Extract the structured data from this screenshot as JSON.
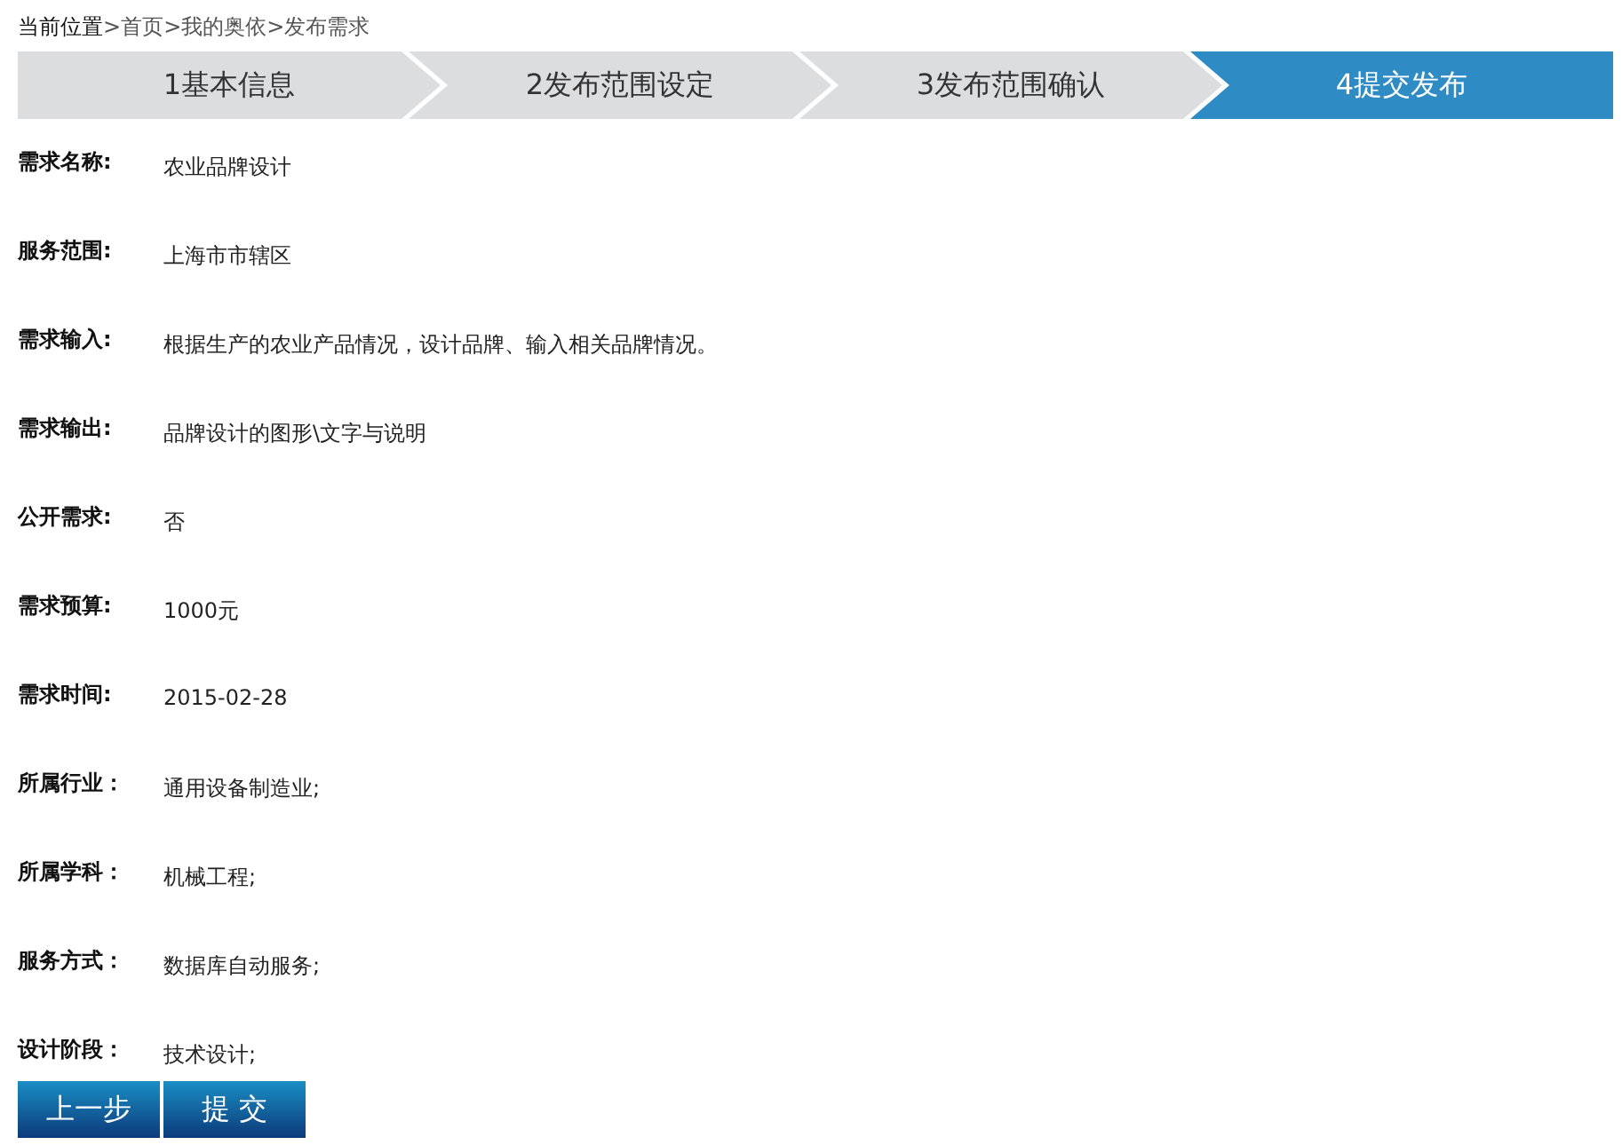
{
  "breadcrumb": {
    "label": "当前位置",
    "separator": ">",
    "items": [
      "首页",
      "我的奥依",
      "发布需求"
    ]
  },
  "steps": [
    {
      "label": "1基本信息",
      "selected": false
    },
    {
      "label": "2发布范围设定",
      "selected": false
    },
    {
      "label": "3发布范围确认",
      "selected": false
    },
    {
      "label": "4提交发布",
      "selected": true
    }
  ],
  "fields": [
    {
      "label": "需求名称:",
      "value": "农业品牌设计"
    },
    {
      "label": "服务范围:",
      "value": "上海市市辖区"
    },
    {
      "label": "需求输入:",
      "value": "根据生产的农业产品情况，设计品牌、输入相关品牌情况。"
    },
    {
      "label": "需求输出:",
      "value": "品牌设计的图形\\文字与说明"
    },
    {
      "label": "公开需求:",
      "value": "否"
    },
    {
      "label": "需求预算:",
      "value": "1000元"
    },
    {
      "label": "需求时间:",
      "value": "2015-02-28"
    },
    {
      "label": "所属行业：",
      "value": "通用设备制造业;"
    },
    {
      "label": "所属学科：",
      "value": "机械工程;"
    },
    {
      "label": "服务方式：",
      "value": "数据库自动服务;"
    },
    {
      "label": "设计阶段：",
      "value": "技术设计;"
    }
  ],
  "buttons": [
    "上一步",
    "提 交"
  ]
}
